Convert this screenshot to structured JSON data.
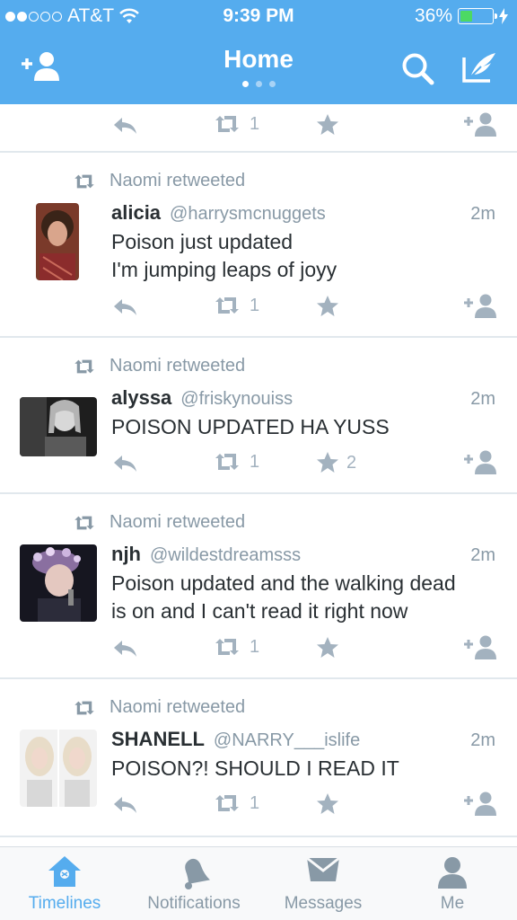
{
  "status_bar": {
    "carrier": "AT&T",
    "time": "9:39 PM",
    "battery": "36%"
  },
  "header": {
    "title": "Home"
  },
  "top_partial_tweet": {
    "retweets": "1",
    "favorites": ""
  },
  "tweets": [
    {
      "retweeted_by": "Naomi retweeted",
      "name": "alicia",
      "handle": "@harrysmcnuggets",
      "time": "2m",
      "text_lines": [
        "Poison just updated",
        "I'm jumping leaps of joyy"
      ],
      "retweets": "1",
      "favorites": ""
    },
    {
      "retweeted_by": "Naomi retweeted",
      "name": "alyssa",
      "handle": "@friskynouiss",
      "time": "2m",
      "text_lines": [
        "POISON UPDATED HA YUSS"
      ],
      "retweets": "1",
      "favorites": "2"
    },
    {
      "retweeted_by": "Naomi retweeted",
      "name": "njh",
      "handle": "@wildestdreamsss",
      "time": "2m",
      "text_lines": [
        "Poison updated and the walking dead",
        "is on and I can't read it right now"
      ],
      "retweets": "1",
      "favorites": ""
    },
    {
      "retweeted_by": "Naomi retweeted",
      "name": "SHANELL",
      "handle": "@NARRY___islife",
      "time": "2m",
      "text_lines": [
        "POISON?! SHOULD I READ IT"
      ],
      "retweets": "1",
      "favorites": ""
    }
  ],
  "tab_bar": {
    "tabs": [
      {
        "label": "Timelines",
        "icon": "home-icon",
        "active": true
      },
      {
        "label": "Notifications",
        "icon": "bell-icon",
        "active": false
      },
      {
        "label": "Messages",
        "icon": "envelope-icon",
        "active": false
      },
      {
        "label": "Me",
        "icon": "person-icon",
        "active": false
      }
    ]
  },
  "colors": {
    "brand": "#55acee",
    "muted": "#8899a6",
    "action": "#a3b2bf",
    "text": "#292f33"
  }
}
